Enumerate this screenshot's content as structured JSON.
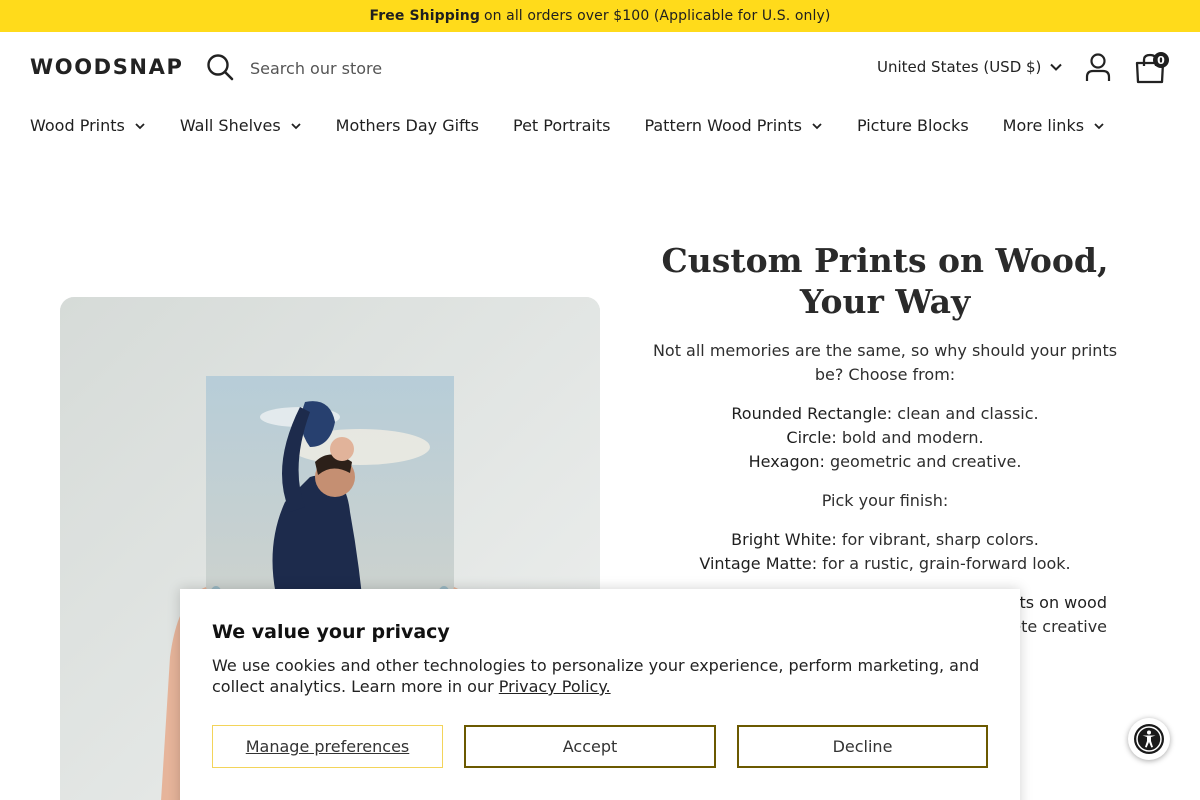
{
  "announcement": {
    "bold": "Free Shipping",
    "rest": "on all orders over $100 (Applicable for U.S. only)"
  },
  "header": {
    "logo": "WOODSNAP",
    "search_placeholder": "Search our store",
    "country": "United States (USD $)",
    "cart_count": "0"
  },
  "nav": [
    {
      "label": "Wood Prints",
      "has_dropdown": true
    },
    {
      "label": "Wall Shelves",
      "has_dropdown": true
    },
    {
      "label": "Mothers Day Gifts",
      "has_dropdown": false
    },
    {
      "label": "Pet Portraits",
      "has_dropdown": false
    },
    {
      "label": "Pattern Wood Prints",
      "has_dropdown": true
    },
    {
      "label": "Picture Blocks",
      "has_dropdown": false
    },
    {
      "label": "More links",
      "has_dropdown": true
    }
  ],
  "main": {
    "heading_line1": "Custom Prints on Wood,",
    "heading_line2": "Your Way",
    "intro": "Not all memories are the same, so why should your prints be? Choose from:",
    "shapes": [
      {
        "label": "Rounded Rectangle:",
        "text": " clean and classic."
      },
      {
        "label": "Circle:",
        "text": " bold and modern."
      },
      {
        "label": "Hexagon:",
        "text": " geometric and creative."
      }
    ],
    "finish_intro": "Pick your finish:",
    "finishes": [
      {
        "label": "Bright White:",
        "text": " for vibrant, sharp colors."
      },
      {
        "label": "Vintage Matte:",
        "text": " for a rustic, grain-forward look."
      }
    ],
    "partial_line1": "ts on wood",
    "partial_line2": "ete creative"
  },
  "cookie": {
    "title": "We value your privacy",
    "description": "We use cookies and other technologies to personalize your experience, perform marketing, and collect analytics. Learn more in our ",
    "link": "Privacy Policy.",
    "manage": "Manage preferences",
    "accept": "Accept",
    "decline": "Decline"
  },
  "colors": {
    "announcement_bg": "#ffdb1b",
    "button_border": "#6b5900"
  },
  "icons": [
    "search-icon",
    "chevron-down-icon",
    "account-icon",
    "cart-icon",
    "accessibility-icon"
  ]
}
